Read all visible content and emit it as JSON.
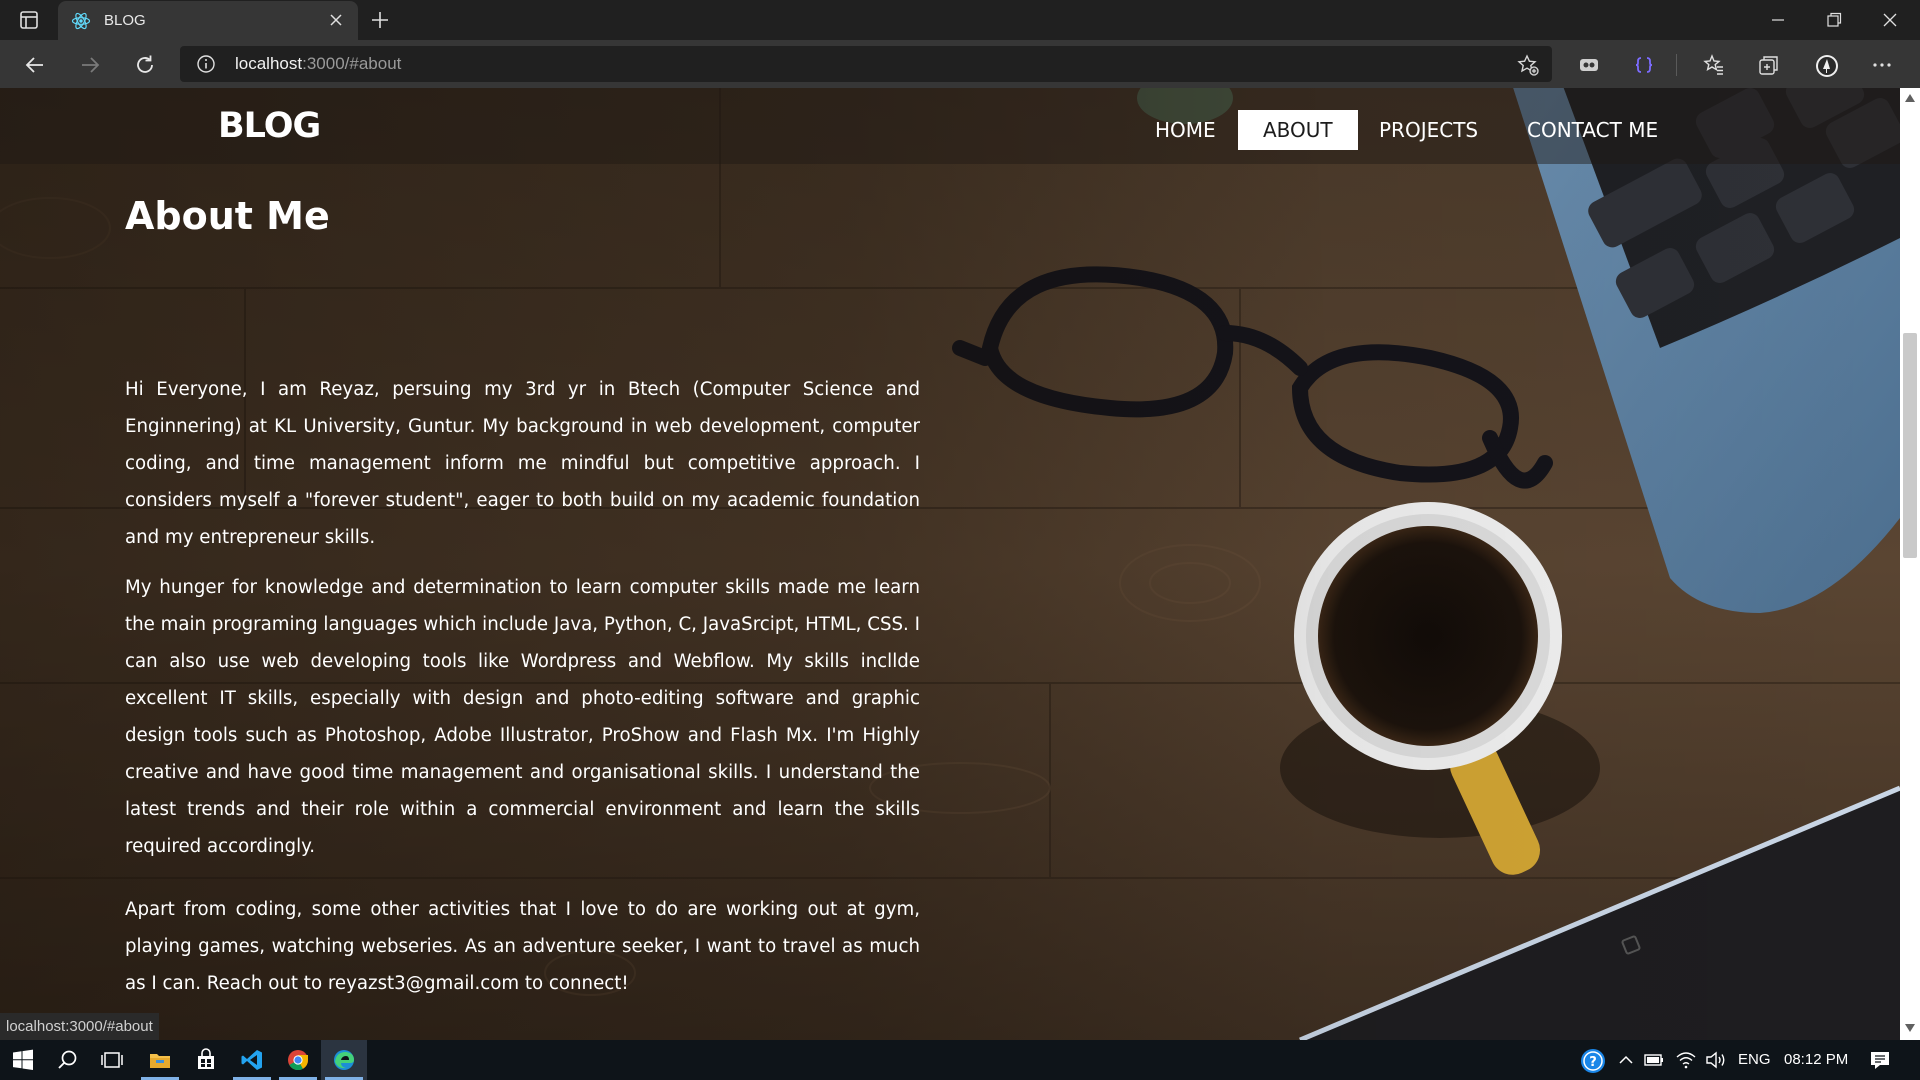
{
  "browser": {
    "tab_title": "BLOG",
    "url_host": "localhost",
    "url_rest": ":3000/#about",
    "status_link": "localhost:3000/#about"
  },
  "site": {
    "brand": "BLOG",
    "nav": [
      {
        "label": "HOME",
        "active": false
      },
      {
        "label": "ABOUT",
        "active": true
      },
      {
        "label": "PROJECTS",
        "active": false
      },
      {
        "label": "CONTACT ME",
        "active": false
      }
    ]
  },
  "about": {
    "heading": "About Me",
    "paragraphs": [
      "Hi Everyone, I am Reyaz, persuing my 3rd yr in Btech (Computer Science and Enginnering) at KL University, Guntur. My background in web development, computer coding, and time management inform me mindful but competitive approach. I considers myself a \"forever student\", eager to both build on my academic foundation and my entrepreneur skills.",
      "My hunger for knowledge and determination to learn computer skills made me learn the main programing languages which include Java, Python, C, JavaSrcipt, HTML, CSS. I can also use web developing tools like Wordpress and Webflow. My skills incllde excellent IT skills, especially with design and photo-editing software and graphic design tools such as Photoshop, Adobe Illustrator, ProShow and Flash Mx. I'm Highly creative and have good time management and organisational skills. I understand the latest trends and their role within a commercial environment and learn the skills required accordingly.",
      "Apart from coding, some other activities that I love to do are working out at gym, playing games, watching webseries. As an adventure seeker, I want to travel as much as I can. Reach out to reyazst3@gmail.com to connect!"
    ]
  },
  "taskbar": {
    "language": "ENG",
    "time": "08:12 PM"
  },
  "colors": {
    "browser_bg": "#202020",
    "toolbar_bg": "#363636",
    "taskbar_bg": "#0e1419",
    "nav_active_bg": "#ffffff"
  }
}
